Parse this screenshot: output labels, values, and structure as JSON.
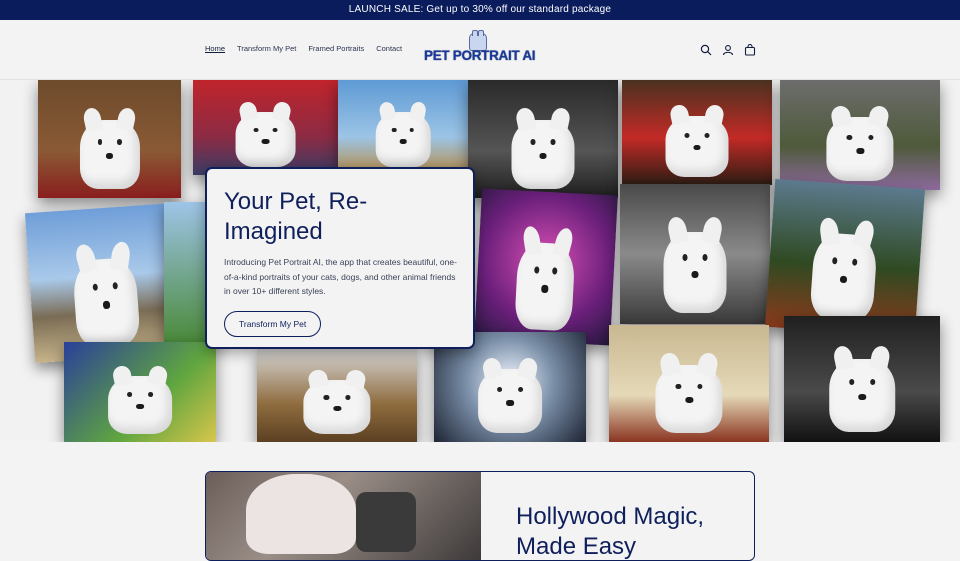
{
  "announcement": "LAUNCH SALE: Get up to 30% off our standard package",
  "nav": [
    "Home",
    "Transform My Pet",
    "Framed Portraits",
    "Contact"
  ],
  "logo_text": "PET PORTRAIT AI",
  "header_icons": [
    "search-icon",
    "account-icon",
    "cart-icon"
  ],
  "hero": {
    "title": "Your Pet, Re-Imagined",
    "description": "Introducing Pet Portrait AI, the app that creates beautiful, one-of-a-kind portraits of your cats, dogs, and other animal friends in over 10+ different styles.",
    "button": "Transform My Pet"
  },
  "section2": {
    "title": "Hollywood Magic, Made Easy"
  },
  "colors": {
    "navy": "#0f1f5c",
    "announcement_bg": "#0a1c5c",
    "page_bg": "#f3f3f3"
  }
}
